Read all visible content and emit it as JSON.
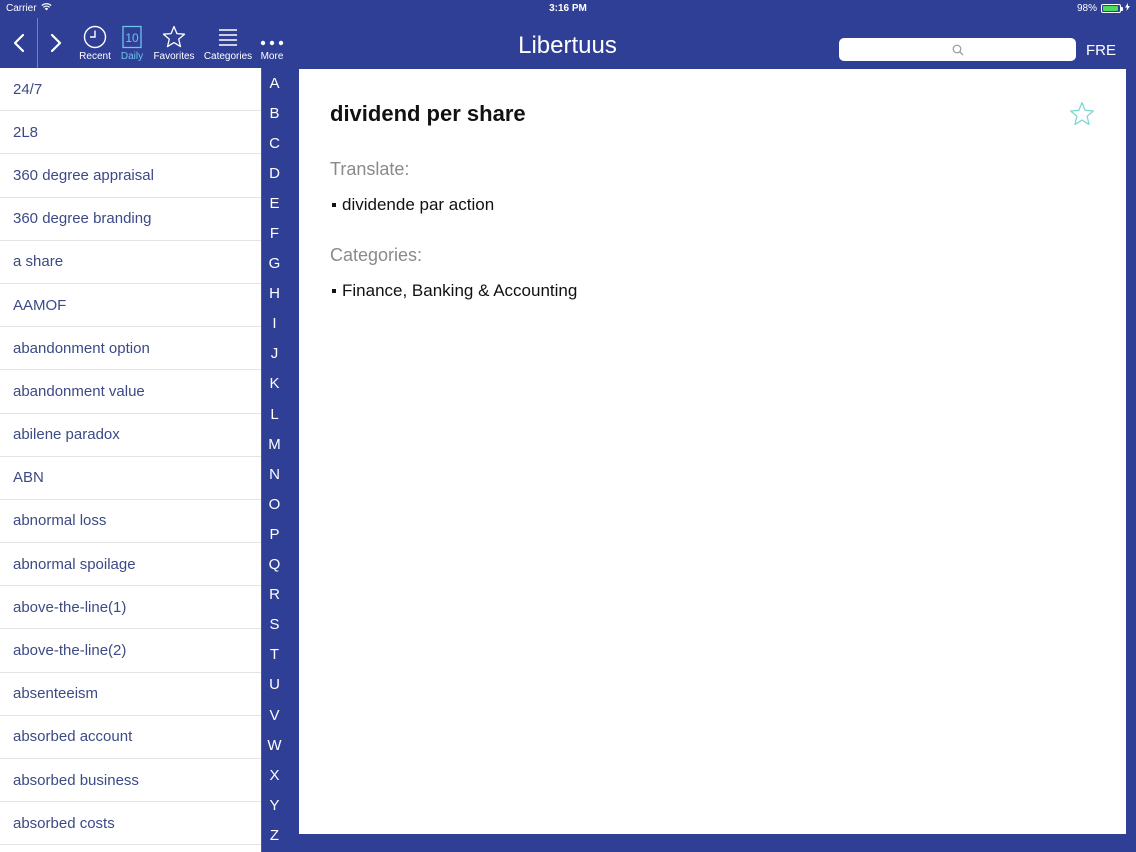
{
  "status": {
    "carrier": "Carrier",
    "time": "3:16 PM",
    "battery": "98%"
  },
  "toolbar": {
    "recent_label": "Recent",
    "daily_label": "Daily",
    "daily_number": "10",
    "favorites_label": "Favorites",
    "categories_label": "Categories",
    "more_label": "More"
  },
  "header": {
    "title": "Libertuus",
    "language": "FRE"
  },
  "search": {
    "value": "",
    "placeholder": ""
  },
  "word_list": [
    "24/7",
    "2L8",
    "360 degree appraisal",
    "360 degree branding",
    "a share",
    "AAMOF",
    "abandonment option",
    "abandonment value",
    "abilene paradox",
    "ABN",
    "abnormal loss",
    "abnormal spoilage",
    "above-the-line(1)",
    "above-the-line(2)",
    "absenteeism",
    "absorbed account",
    "absorbed business",
    "absorbed costs"
  ],
  "alphabet": [
    "A",
    "B",
    "C",
    "D",
    "E",
    "F",
    "G",
    "H",
    "I",
    "J",
    "K",
    "L",
    "M",
    "N",
    "O",
    "P",
    "Q",
    "R",
    "S",
    "T",
    "U",
    "V",
    "W",
    "X",
    "Y",
    "Z"
  ],
  "detail": {
    "term": "dividend per share",
    "translate_label": "Translate:",
    "translation": "dividende par action",
    "categories_label": "Categories:",
    "category": "Finance, Banking & Accounting"
  },
  "colors": {
    "bar": "#2f3f95",
    "active": "#6ec3ea",
    "list_text": "#3c4a86",
    "favorite_star": "#7fd8d0"
  }
}
